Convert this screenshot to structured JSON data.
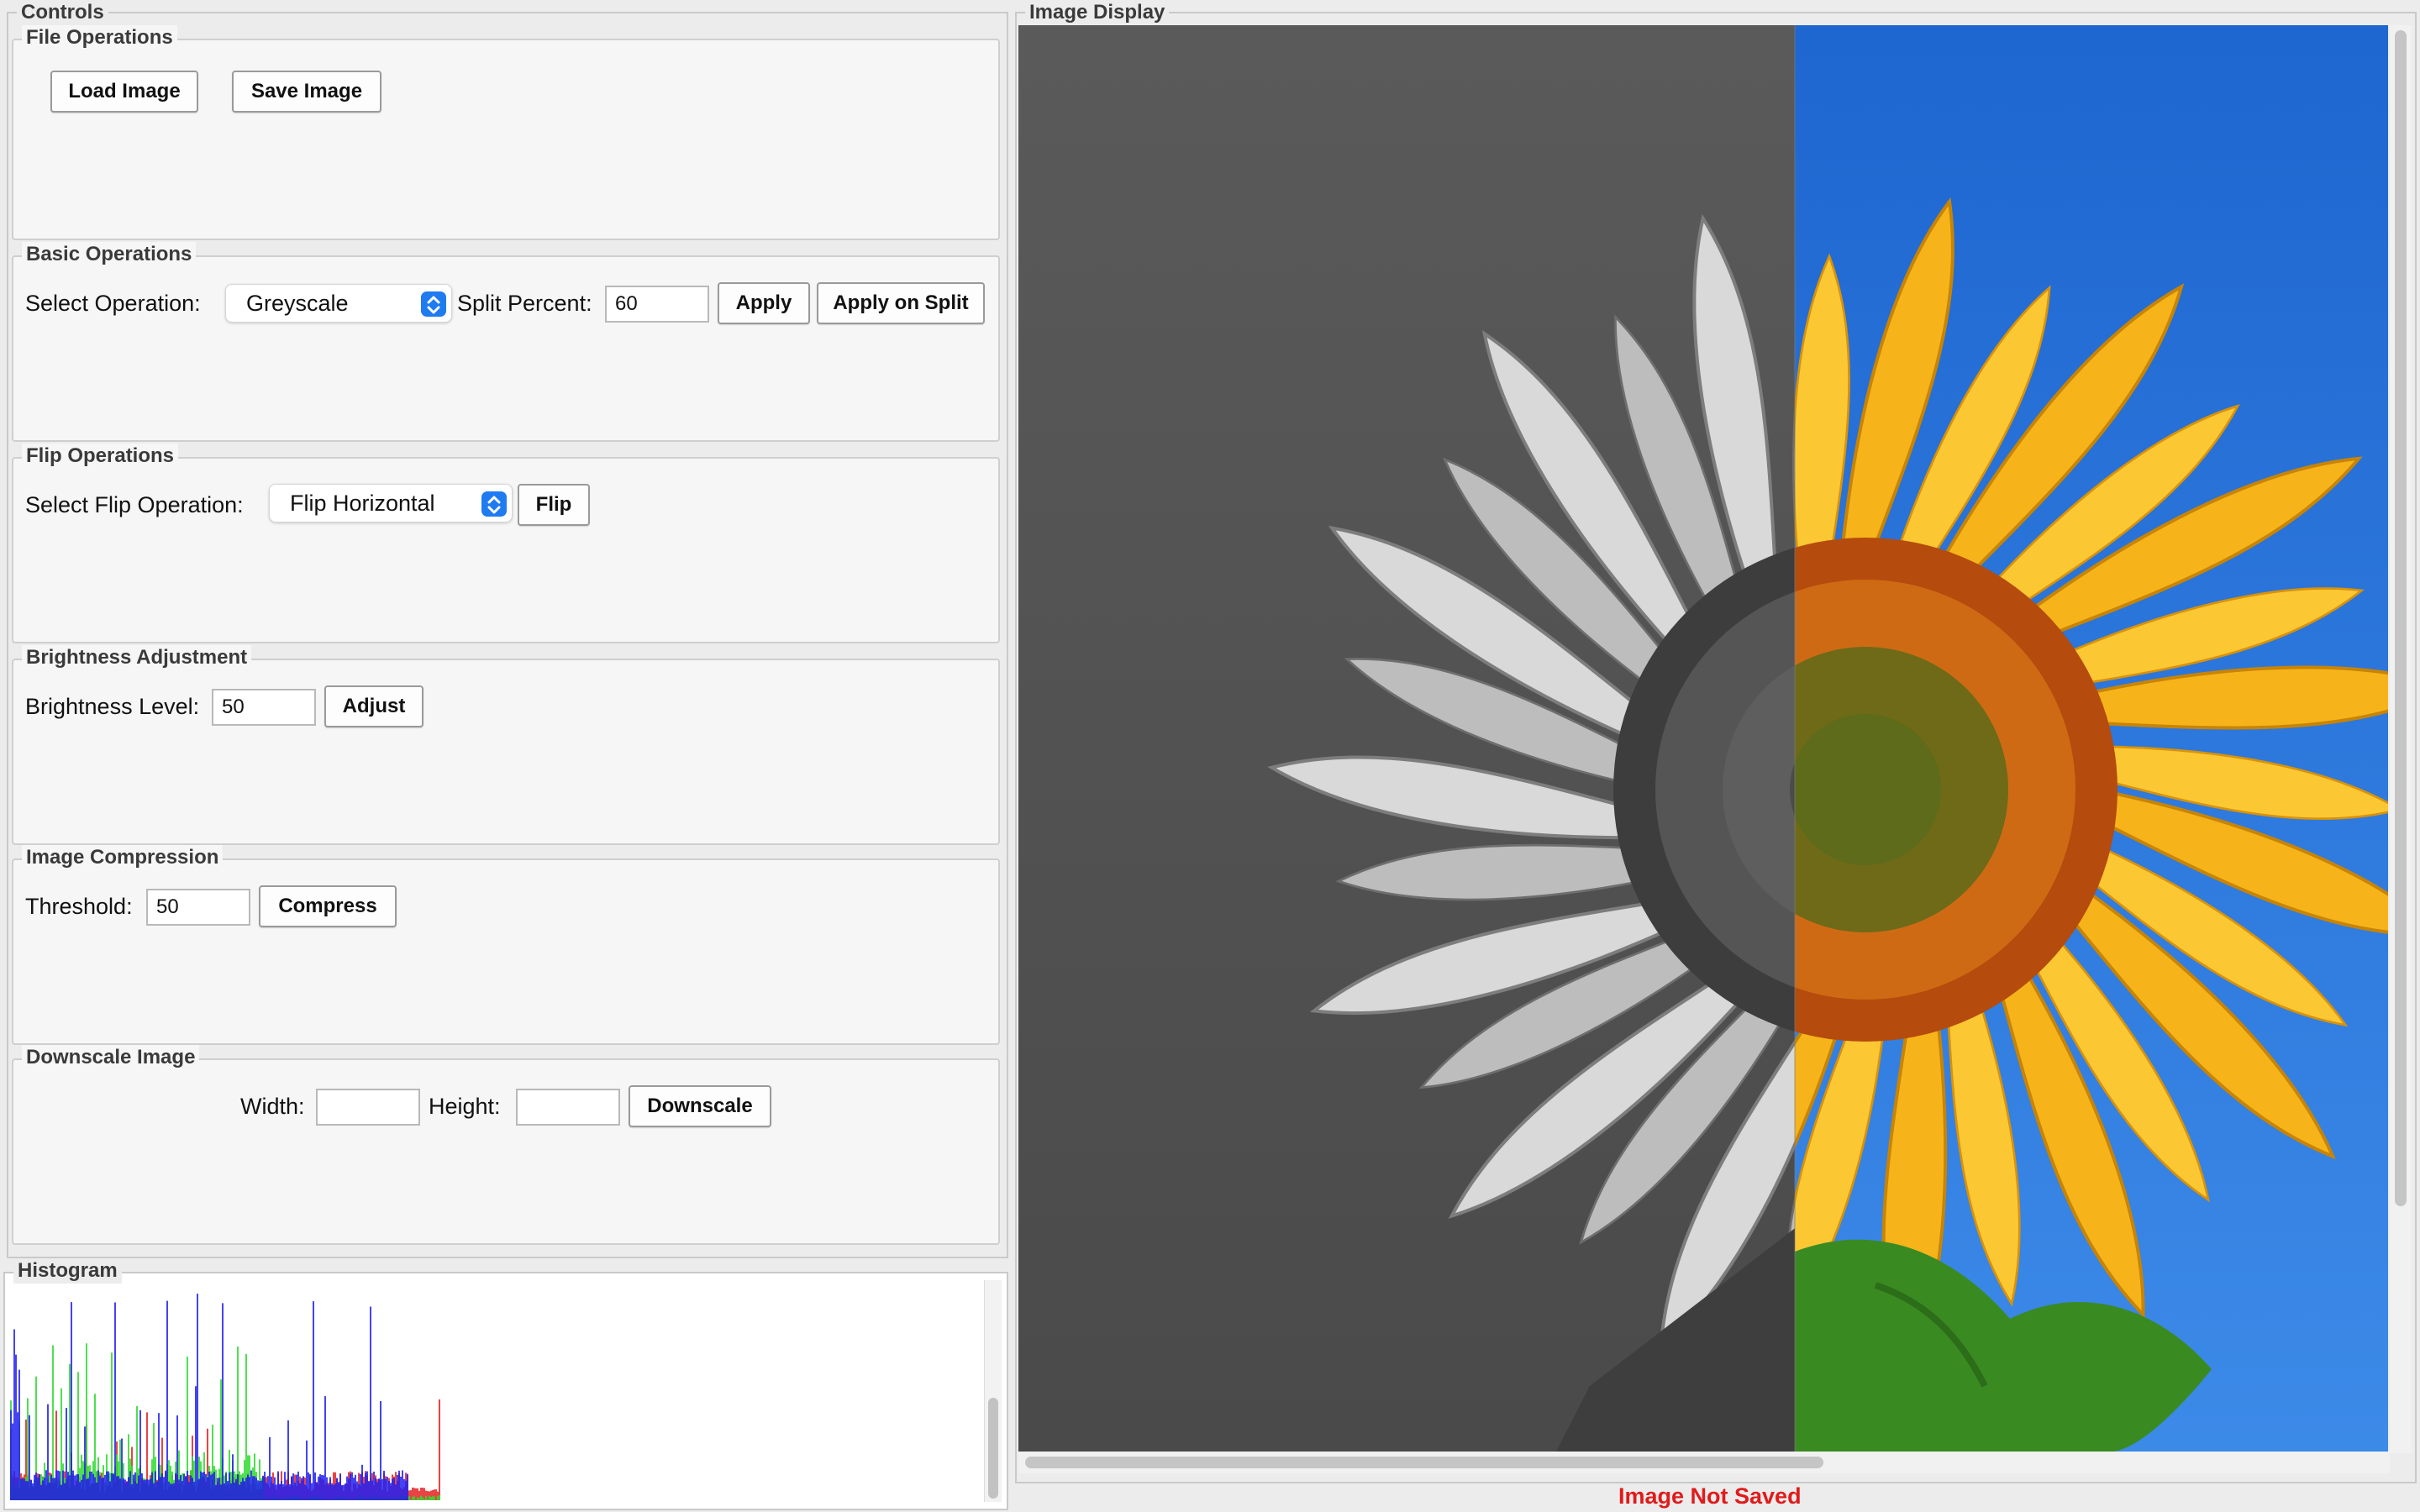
{
  "controls": {
    "title": "Controls",
    "file_operations": {
      "title": "File Operations",
      "load_label": "Load Image",
      "save_label": "Save Image"
    },
    "basic_operations": {
      "title": "Basic Operations",
      "select_label": "Select Operation:",
      "selected_operation": "Greyscale",
      "split_label": "Split Percent:",
      "split_value": "60",
      "apply_label": "Apply",
      "apply_split_label": "Apply on Split"
    },
    "flip_operations": {
      "title": "Flip Operations",
      "select_label": "Select Flip Operation:",
      "selected_flip": "Flip Horizontal",
      "flip_label": "Flip"
    },
    "brightness": {
      "title": "Brightness Adjustment",
      "level_label": "Brightness Level:",
      "level_value": "50",
      "adjust_label": "Adjust"
    },
    "compression": {
      "title": "Image Compression",
      "threshold_label": "Threshold:",
      "threshold_value": "50",
      "compress_label": "Compress"
    },
    "downscale": {
      "title": "Downscale Image",
      "width_label": "Width:",
      "width_value": "",
      "height_label": "Height:",
      "height_value": "",
      "downscale_label": "Downscale"
    }
  },
  "histogram": {
    "title": "Histogram",
    "colors": {
      "red": "#e41414",
      "green": "#22d922",
      "blue": "#1414f0"
    }
  },
  "image_display": {
    "title": "Image Display",
    "status": "Image Not Saved",
    "split_percent_shown": 57
  },
  "colors": {
    "accent": "#1f7bf0",
    "status_error": "#e01b1b",
    "sky": "#2a78d6",
    "petal": "#f6b41a"
  }
}
